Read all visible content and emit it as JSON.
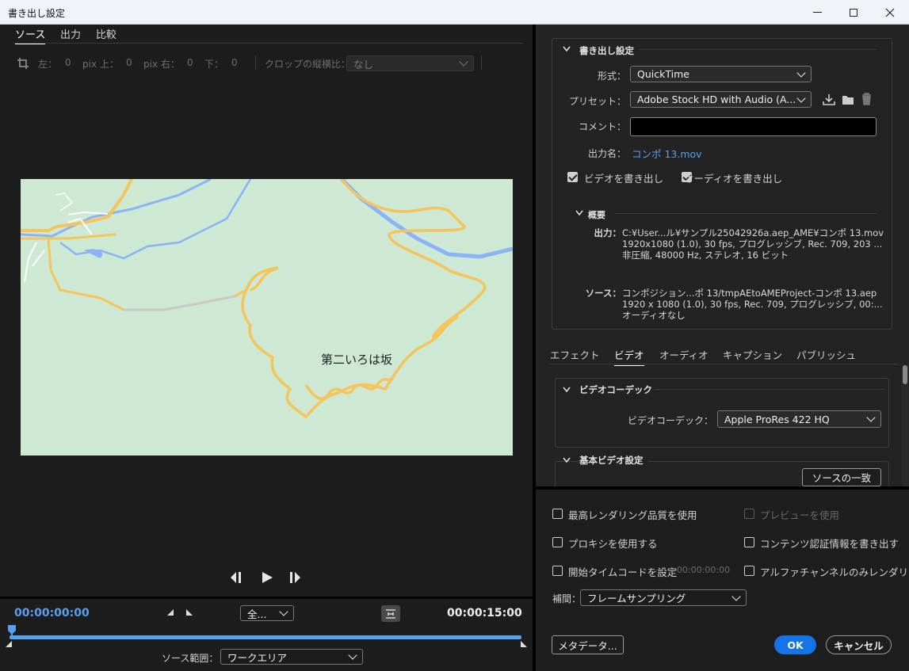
{
  "window": {
    "title": "書き出し設定"
  },
  "source_tabs": [
    {
      "label": "ソース"
    },
    {
      "label": "出力"
    },
    {
      "label": "比較"
    }
  ],
  "crop": {
    "left_label": "左：",
    "left_value": "0",
    "top_label": "pix 上：",
    "top_value": "0",
    "right_label": "pix 右：",
    "right_value": "0",
    "bottom_label": "下：",
    "bottom_value": "0",
    "ratio_label": "クロップの縦横比：",
    "ratio_value": "なし"
  },
  "preview": {
    "map_label": "第二いろは坂",
    "map_land_color": "#cde8d3",
    "water_color": "#8ab4f8",
    "road_color": "#f5c45a"
  },
  "timeline": {
    "current_time": "00:00:00:00",
    "end_time": "00:00:15:00",
    "zoom_value": "全...",
    "source_range_label": "ソース範囲：",
    "source_range_value": "ワークエリア",
    "accent": "#5aa0f0"
  },
  "export_settings": {
    "header": "書き出し設定",
    "format_label": "形式：",
    "format_value": "QuickTime",
    "preset_label": "プリセット：",
    "preset_value": "Adobe Stock HD with Audio (A...",
    "comment_label": "コメント：",
    "comment_value": "",
    "output_name_label": "出力名：",
    "output_name_value": "コンポ 13.mov",
    "export_video_label": "ビデオを書き出し",
    "export_audio_label": "オーディオを書き出し"
  },
  "summary": {
    "header": "概要",
    "output_label": "出力：",
    "output_lines": [
      "C:¥User...ル¥サンプル25042926a.aep_AME¥コンポ 13.mov",
      "1920x1080 (1.0), 30 fps, プログレッシブ, Rec. 709, 203 ...",
      "非圧縮, 48000 Hz, ステレオ, 16 ビット"
    ],
    "source_label": "ソース：",
    "source_lines": [
      "コンポジション...ポ 13/tmpAEtoAMEProject-コンポ 13.aep",
      "1920 x 1080 (1.0), 30 fps, Rec. 709, プログレッシブ, 00:...",
      "オーディオなし"
    ]
  },
  "settings_tabs": [
    {
      "label": "エフェクト"
    },
    {
      "label": "ビデオ"
    },
    {
      "label": "オーディオ"
    },
    {
      "label": "キャプション"
    },
    {
      "label": "パブリッシュ"
    }
  ],
  "video": {
    "codec_header": "ビデオコーデック",
    "codec_label": "ビデオコーデック：",
    "codec_value": "Apple ProRes 422 HQ",
    "basic_header": "基本ビデオ設定",
    "match_source": "ソースの一致"
  },
  "options": {
    "max_quality": "最高レンダリング品質を使用",
    "use_preview": "プレビューを使用",
    "use_proxy": "プロキシを使用する",
    "content_credentials": "コンテンツ認証情報を書き出す",
    "start_timecode": "開始タイムコードを設定",
    "start_timecode_value": "00:00:00:00",
    "alpha_only": "アルファチャンネルのみレンダリング",
    "interp_label": "補間：",
    "interp_value": "フレームサンプリング"
  },
  "buttons": {
    "metadata": "メタデータ...",
    "ok": "OK",
    "cancel": "キャンセル",
    "ok_color": "#1473e6"
  }
}
